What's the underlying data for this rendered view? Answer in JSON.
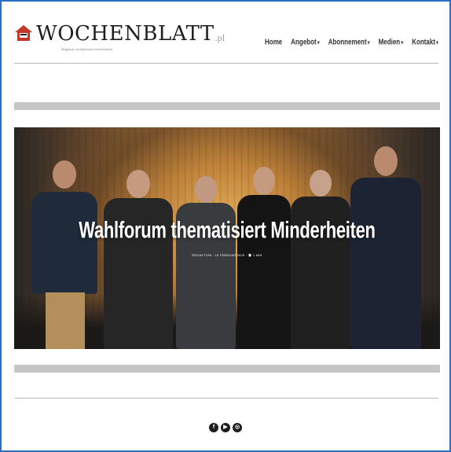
{
  "brand": {
    "name": "WOCHENBLATT",
    "suffix": ".pl",
    "tagline": "Magazyn mniejszości niemieckiej",
    "accent_color": "#c0392b",
    "icon": "house-logo-icon"
  },
  "nav": {
    "items": [
      {
        "label": "Home",
        "dropdown": false
      },
      {
        "label": "Angebot",
        "dropdown": true
      },
      {
        "label": "Abonnement",
        "dropdown": true
      },
      {
        "label": "Medien",
        "dropdown": true
      },
      {
        "label": "Kontakt",
        "dropdown": true
      }
    ],
    "caret": "▾"
  },
  "hero": {
    "title": "Wahlforum thematisiert Minderheiten",
    "meta": "REDAKTION · 15 FEBRUAR 2025 · ⌚ 1 MIN"
  },
  "social": {
    "icons": [
      {
        "name": "facebook-icon",
        "glyph": "f"
      },
      {
        "name": "youtube-icon",
        "glyph": "▶"
      },
      {
        "name": "instagram-icon",
        "glyph": "◎"
      }
    ]
  },
  "colors": {
    "frame_border": "#2a6fbf",
    "separator": "#c6c6c6",
    "text": "#333333"
  }
}
